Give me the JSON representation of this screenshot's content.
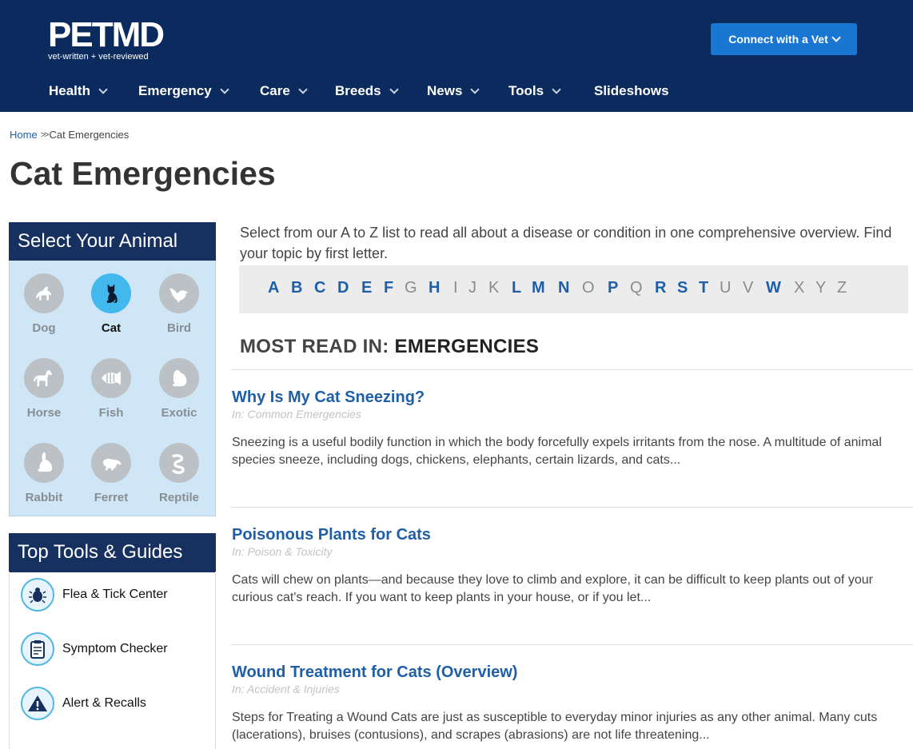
{
  "header": {
    "logo_text": "PETMD",
    "logo_tagline": "vet-written + vet-reviewed",
    "connect_button": "Connect with a Vet"
  },
  "nav": [
    {
      "label": "Health",
      "has_dropdown": true
    },
    {
      "label": "Emergency",
      "has_dropdown": true
    },
    {
      "label": "Care",
      "has_dropdown": true
    },
    {
      "label": "Breeds",
      "has_dropdown": true
    },
    {
      "label": "News",
      "has_dropdown": true
    },
    {
      "label": "Tools",
      "has_dropdown": true
    },
    {
      "label": "Slideshows",
      "has_dropdown": false
    }
  ],
  "breadcrumb": {
    "home": "Home",
    "separator": ">>",
    "current": "Cat Emergencies"
  },
  "page_title": "Cat Emergencies",
  "sidebar": {
    "animal_heading": "Select Your Animal",
    "animals": [
      {
        "label": "Dog",
        "icon": "dog-icon",
        "selected": false
      },
      {
        "label": "Cat",
        "icon": "cat-icon",
        "selected": true
      },
      {
        "label": "Bird",
        "icon": "bird-icon",
        "selected": false
      },
      {
        "label": "Horse",
        "icon": "horse-icon",
        "selected": false
      },
      {
        "label": "Fish",
        "icon": "fish-icon",
        "selected": false
      },
      {
        "label": "Exotic",
        "icon": "exotic-icon",
        "selected": false
      },
      {
        "label": "Rabbit",
        "icon": "rabbit-icon",
        "selected": false
      },
      {
        "label": "Ferret",
        "icon": "ferret-icon",
        "selected": false
      },
      {
        "label": "Reptile",
        "icon": "reptile-icon",
        "selected": false
      }
    ],
    "tools_heading": "Top Tools & Guides",
    "tools": [
      {
        "label": "Flea & Tick Center",
        "icon": "flea-icon"
      },
      {
        "label": "Symptom Checker",
        "icon": "clipboard-icon"
      },
      {
        "label": "Alert & Recalls",
        "icon": "alert-icon"
      }
    ]
  },
  "intro": "Select from our A to Z list to read all about a disease or condition in one comprehensive overview. Find your topic by first letter.",
  "az": [
    {
      "letter": "A",
      "active": true
    },
    {
      "letter": "B",
      "active": true
    },
    {
      "letter": "C",
      "active": true
    },
    {
      "letter": "D",
      "active": true
    },
    {
      "letter": "E",
      "active": true
    },
    {
      "letter": "F",
      "active": true
    },
    {
      "letter": "G",
      "active": false
    },
    {
      "letter": "H",
      "active": true
    },
    {
      "letter": "I",
      "active": false
    },
    {
      "letter": "J",
      "active": false
    },
    {
      "letter": "K",
      "active": false
    },
    {
      "letter": "L",
      "active": true
    },
    {
      "letter": "M",
      "active": true
    },
    {
      "letter": "N",
      "active": true
    },
    {
      "letter": "O",
      "active": false
    },
    {
      "letter": "P",
      "active": true
    },
    {
      "letter": "Q",
      "active": false
    },
    {
      "letter": "R",
      "active": true
    },
    {
      "letter": "S",
      "active": true
    },
    {
      "letter": "T",
      "active": true
    },
    {
      "letter": "U",
      "active": false
    },
    {
      "letter": "V",
      "active": false
    },
    {
      "letter": "W",
      "active": true
    },
    {
      "letter": "X",
      "active": false
    },
    {
      "letter": "Y",
      "active": false
    },
    {
      "letter": "Z",
      "active": false
    }
  ],
  "most_read": {
    "prefix": "MOST READ IN:",
    "section": "EMERGENCIES"
  },
  "articles": [
    {
      "title": "Why Is My Cat Sneezing?",
      "category": "In: Common Emergencies",
      "excerpt": "Sneezing is a useful bodily function in which the body forcefully expels irritants from the nose. A multitude of animal species sneeze, including dogs, chickens, elephants, certain lizards, and cats..."
    },
    {
      "title": "Poisonous Plants for Cats",
      "category": "In: Poison & Toxicity",
      "excerpt": "Cats will chew on plants—and because they love to climb and explore, it can be difficult to keep plants out of your curious cat's reach. If you want to keep plants in your house, or if you let..."
    },
    {
      "title": "Wound Treatment for Cats (Overview)",
      "category": "In: Accident & Injuries",
      "excerpt": "Steps for Treating a Wound Cats are just as susceptible to everyday minor injuries as any other animal. Many cuts (lacerations), bruises (contusions), and scrapes (abrasions) are not life threatening..."
    }
  ],
  "colors": {
    "header_bg": "#0b2b5e",
    "button": "#1976d2",
    "link": "#1f5fa8",
    "selected_animal": "#42b8ec",
    "animal_panel": "#cfe6f7"
  }
}
